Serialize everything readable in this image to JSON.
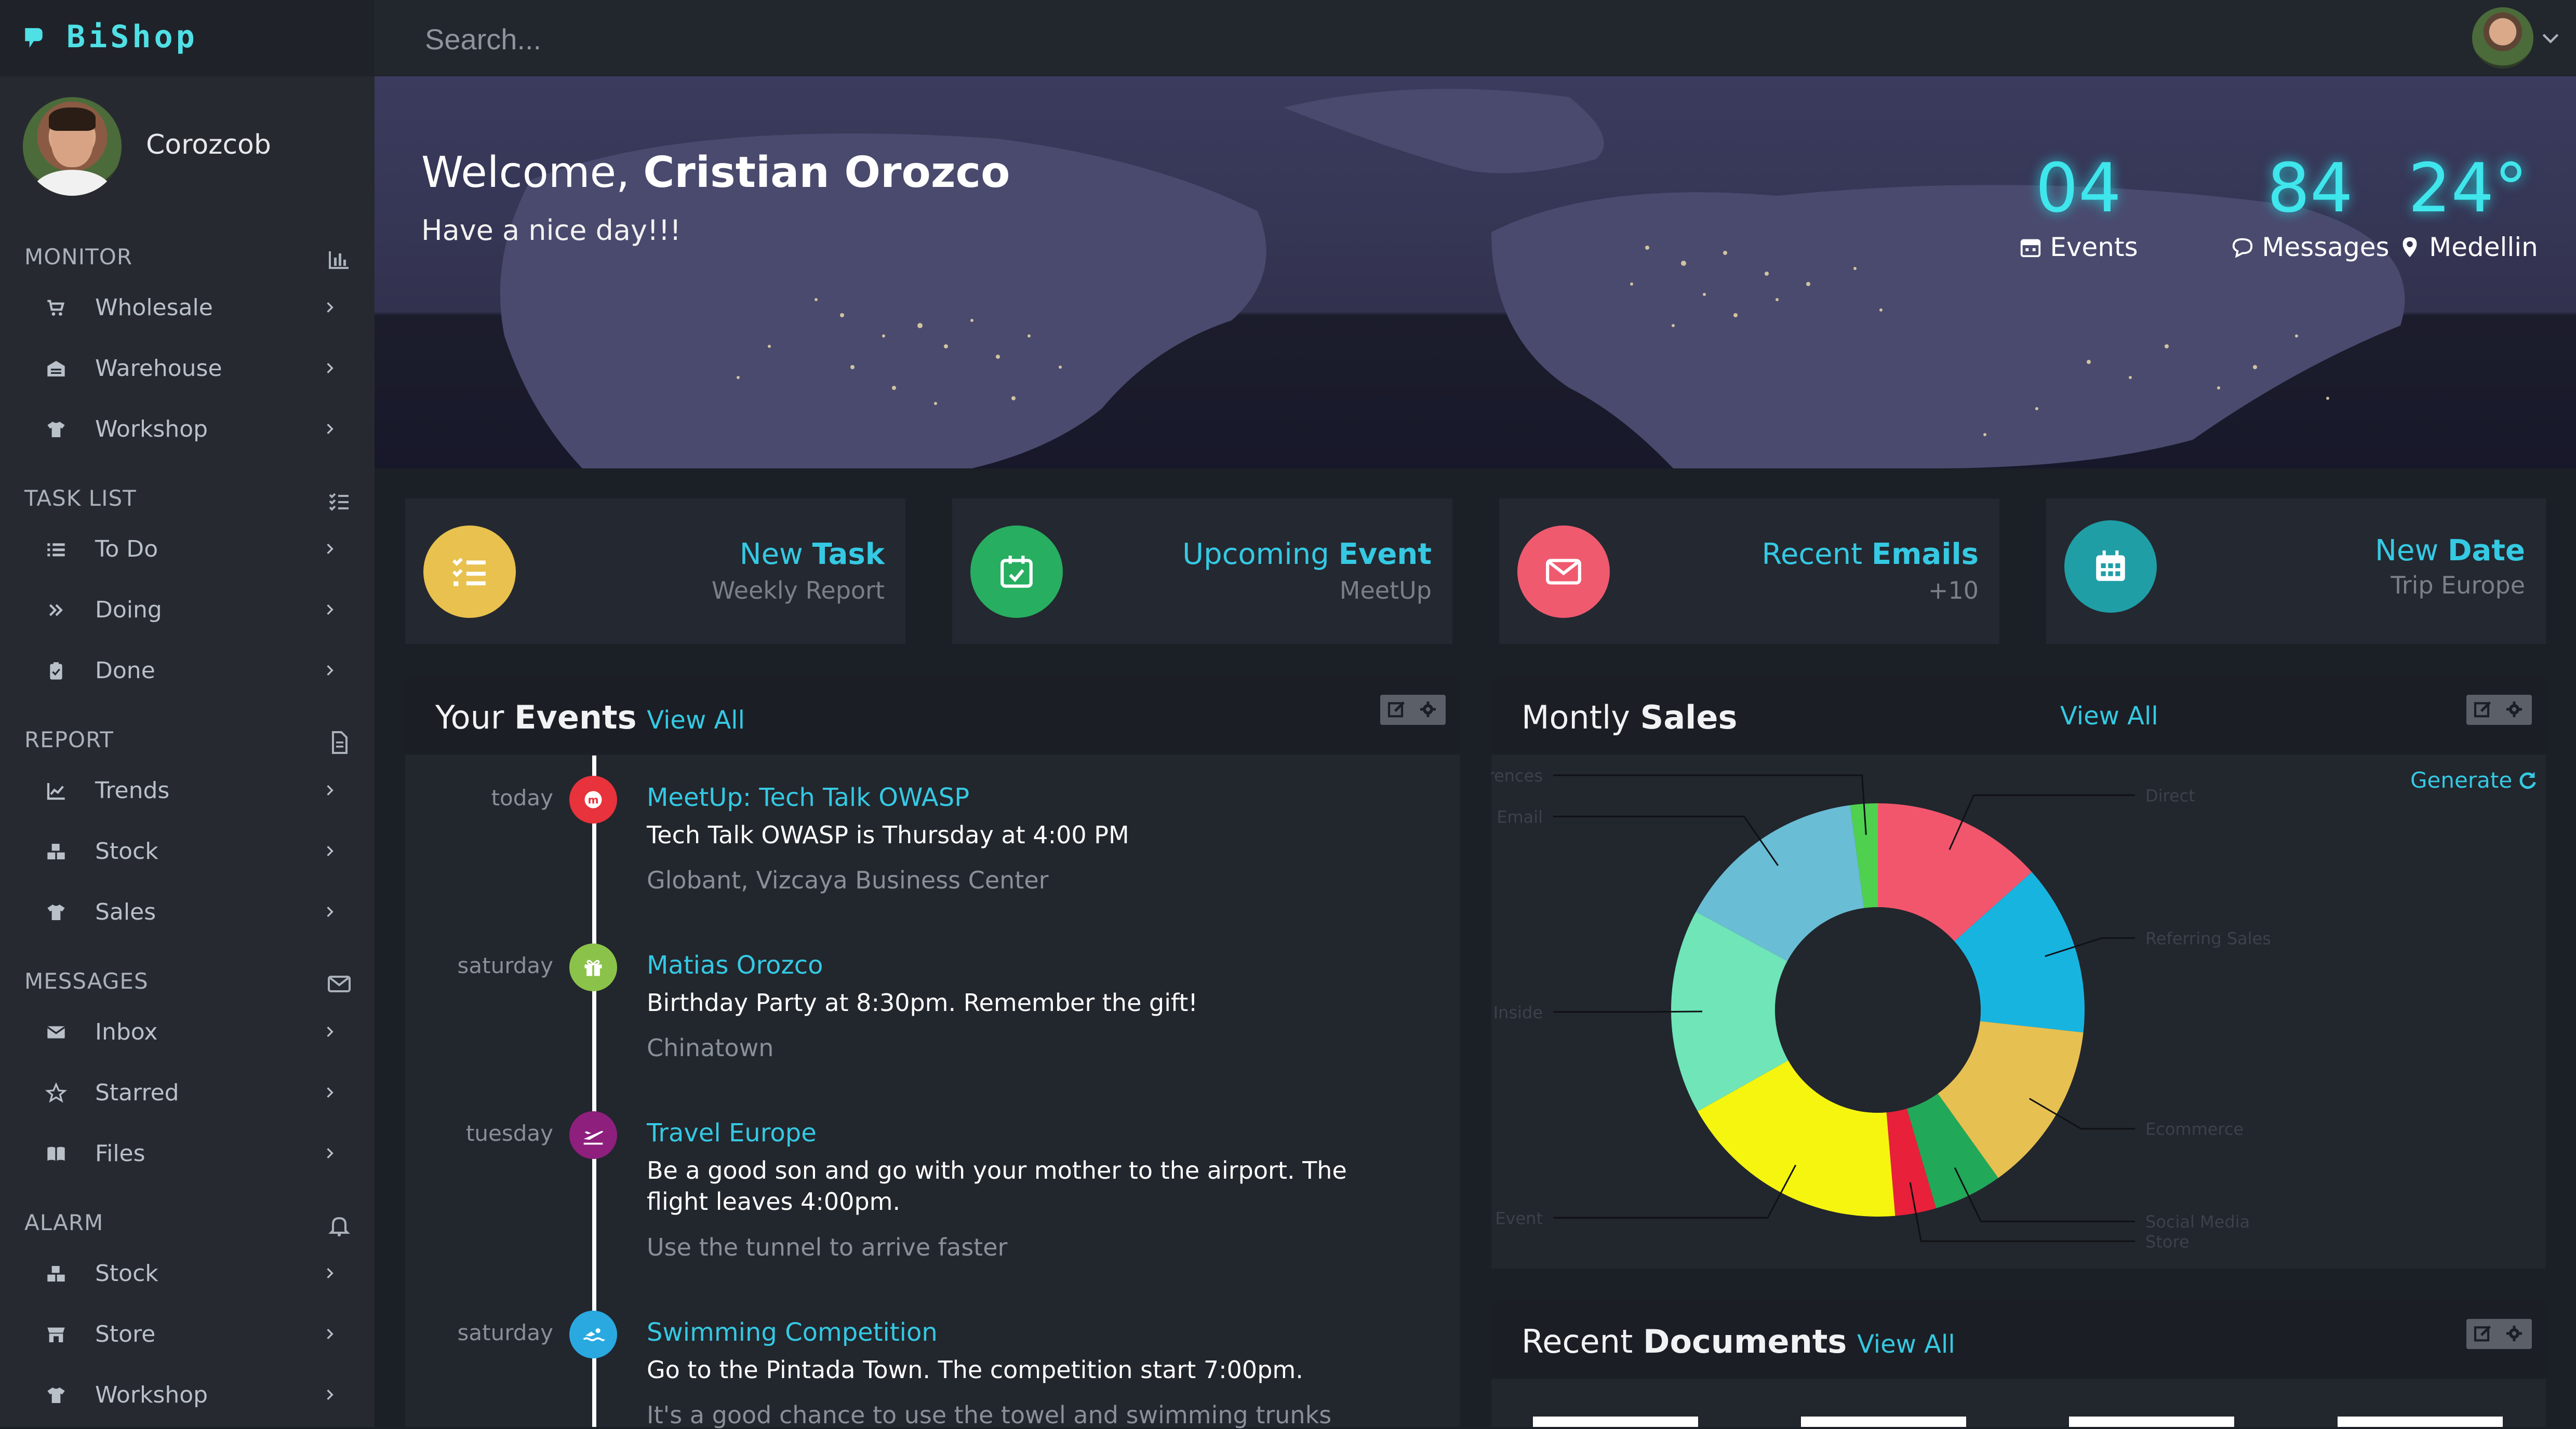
{
  "app": {
    "name": "BiShop"
  },
  "user": {
    "name": "Corozcob"
  },
  "search": {
    "placeholder": "Search..."
  },
  "sidebar": {
    "sections": [
      {
        "title": "MONITOR",
        "icon": "bar-chart-icon",
        "items": [
          {
            "label": "Wholesale",
            "icon": "cart-icon"
          },
          {
            "label": "Warehouse",
            "icon": "warehouse-icon"
          },
          {
            "label": "Workshop",
            "icon": "shirt-icon"
          }
        ]
      },
      {
        "title": "TASK LIST",
        "icon": "checklist-icon",
        "items": [
          {
            "label": "To Do",
            "icon": "list-icon"
          },
          {
            "label": "Doing",
            "icon": "double-chevron-icon"
          },
          {
            "label": "Done",
            "icon": "clipboard-check-icon"
          }
        ]
      },
      {
        "title": "REPORT",
        "icon": "document-icon",
        "items": [
          {
            "label": "Trends",
            "icon": "line-chart-icon"
          },
          {
            "label": "Stock",
            "icon": "boxes-icon"
          },
          {
            "label": "Sales",
            "icon": "shirt-icon"
          }
        ]
      },
      {
        "title": "MESSAGES",
        "icon": "envelope-icon",
        "items": [
          {
            "label": "Inbox",
            "icon": "envelope-icon"
          },
          {
            "label": "Starred",
            "icon": "star-icon"
          },
          {
            "label": "Files",
            "icon": "book-icon"
          }
        ]
      },
      {
        "title": "ALARM",
        "icon": "bell-icon",
        "items": [
          {
            "label": "Stock",
            "icon": "boxes-icon"
          },
          {
            "label": "Store",
            "icon": "store-icon"
          },
          {
            "label": "Workshop",
            "icon": "shirt-icon"
          }
        ]
      }
    ]
  },
  "hero": {
    "welcome_prefix": "Welcome,",
    "welcome_name": "Cristian Orozco",
    "subtitle": "Have a nice day!!!",
    "stats": [
      {
        "value": "04",
        "label": "Events",
        "icon": "calendar-icon"
      },
      {
        "value": "84",
        "label": "Messages",
        "icon": "comment-icon"
      },
      {
        "value": "24°",
        "label": "Medellin",
        "icon": "map-pin-icon"
      }
    ]
  },
  "cards": [
    {
      "title_light": "New",
      "title_bold": "Task",
      "subtitle": "Weekly Report",
      "color": "#e8c14e",
      "icon": "tasks-icon"
    },
    {
      "title_light": "Upcoming",
      "title_bold": "Event",
      "subtitle": "MeetUp",
      "color": "#27ae60",
      "icon": "calendar-check-icon"
    },
    {
      "title_light": "Recent",
      "title_bold": "Emails",
      "subtitle": "+10",
      "color": "#ef5a6f",
      "icon": "envelope-icon"
    },
    {
      "title_light": "New",
      "title_bold": "Date",
      "subtitle": "Trip Europe",
      "color": "#1f9ea6",
      "icon": "calendar-grid-icon"
    }
  ],
  "events_panel": {
    "title_light": "Your",
    "title_bold": "Events",
    "view_all": "View All",
    "events": [
      {
        "day": "today",
        "title": "MeetUp: Tech Talk OWASP",
        "desc": "Tech Talk OWASP is Thursday at 4:00 PM",
        "loc": "Globant, Vizcaya Business Center",
        "color": "#e8323c",
        "icon": "meetup-icon"
      },
      {
        "day": "saturday",
        "title": "Matias Orozco",
        "desc": "Birthday Party at 8:30pm. Remember the gift!",
        "loc": "Chinatown",
        "color": "#8bc34a",
        "icon": "gift-icon"
      },
      {
        "day": "tuesday",
        "title": "Travel Europe",
        "desc": "Be a good son and go with your mother to the airport. The flight leaves 4:00pm.",
        "loc": "Use the tunnel to arrive faster",
        "color": "#8e1f7d",
        "icon": "plane-icon"
      },
      {
        "day": "saturday",
        "title": "Swimming Competition",
        "desc": "Go to the Pintada Town. The competition start 7:00pm.",
        "loc": "It's a good chance to use the towel and swimming trunks",
        "color": "#29a9e0",
        "icon": "swimmer-icon"
      }
    ]
  },
  "sales_panel": {
    "title_light": "Montly",
    "title_bold": "Sales",
    "view_all": "View All",
    "generate": "Generate"
  },
  "documents_panel": {
    "title_light": "Recent",
    "title_bold": "Documents",
    "view_all": "View All"
  },
  "chart_data": {
    "type": "pie",
    "style": "donut",
    "categories": [
      "Direct",
      "Referring Sales",
      "Ecommerce",
      "Social Media",
      "Store",
      "Event",
      "Inside",
      "Email",
      "Conferences"
    ],
    "values": [
      12.5,
      12.5,
      12.5,
      5,
      3,
      17,
      15,
      14,
      2
    ],
    "colors": [
      "#f2566d",
      "#18b4e0",
      "#e6c051",
      "#22a859",
      "#e8203a",
      "#f5f50f",
      "#6fe5b8",
      "#69bdd4",
      "#4fd14f"
    ],
    "legend": "callout-labels"
  }
}
